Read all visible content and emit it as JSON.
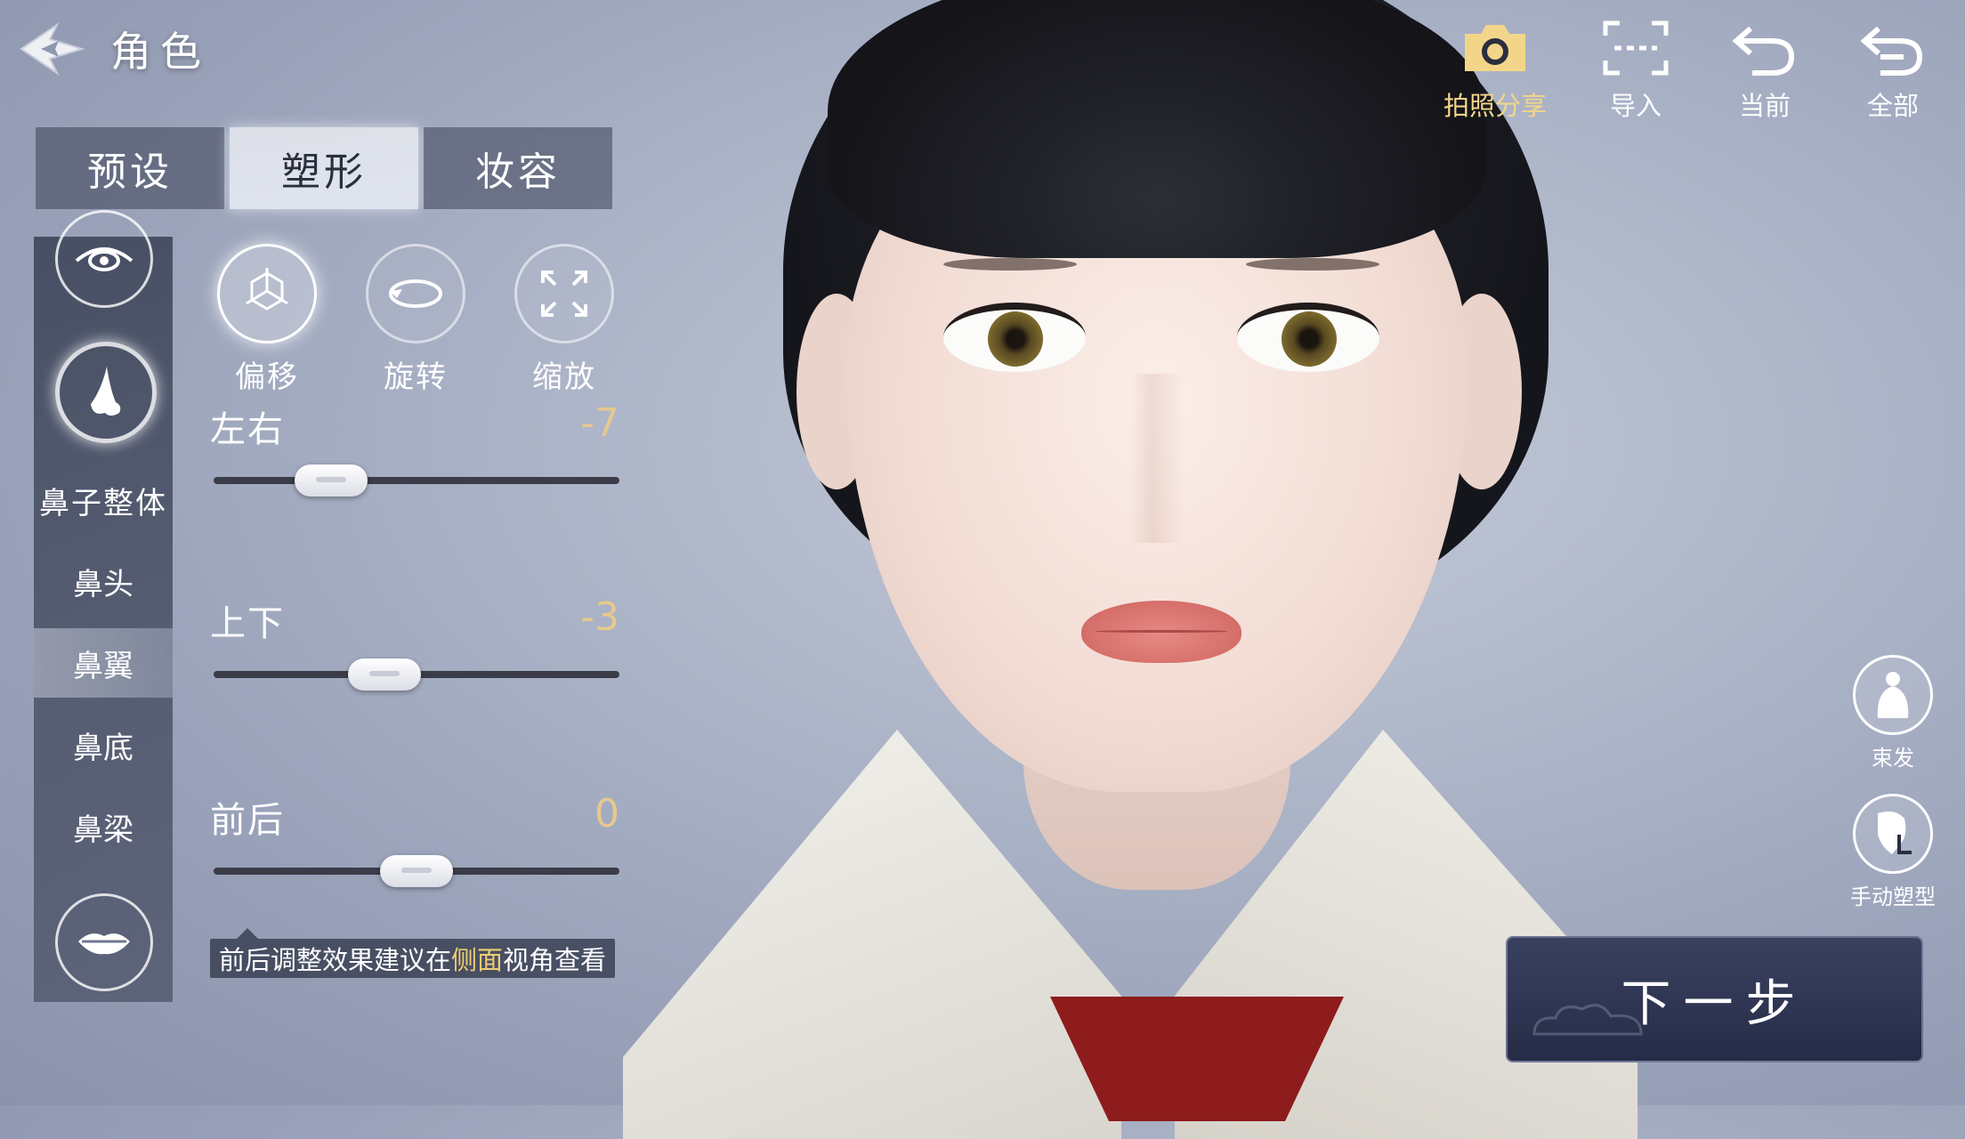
{
  "header": {
    "title": "角色"
  },
  "tabs": [
    {
      "label": "预设",
      "active": false
    },
    {
      "label": "塑形",
      "active": true
    },
    {
      "label": "妆容",
      "active": false
    }
  ],
  "top_tools": [
    {
      "label": "拍照分享",
      "icon": "camera-icon",
      "color": "#f3d58a"
    },
    {
      "label": "导入",
      "icon": "import-scan-icon"
    },
    {
      "label": "当前",
      "icon": "undo-icon"
    },
    {
      "label": "全部",
      "icon": "undo-all-icon"
    }
  ],
  "sidebar": {
    "top_icon": "eye-icon",
    "active_icon": "nose-icon",
    "active_label": "鼻子整体",
    "items": [
      {
        "label": "鼻头",
        "selected": false
      },
      {
        "label": "鼻翼",
        "selected": true
      },
      {
        "label": "鼻底",
        "selected": false
      },
      {
        "label": "鼻梁",
        "selected": false
      }
    ],
    "bottom_icon": "lips-icon"
  },
  "modes": [
    {
      "label": "偏移",
      "icon": "axis-3d-icon",
      "active": true
    },
    {
      "label": "旋转",
      "icon": "rotate-icon",
      "active": false
    },
    {
      "label": "缩放",
      "icon": "scale-icon",
      "active": false
    }
  ],
  "sliders": [
    {
      "name": "左右",
      "value": "-7",
      "fraction": 0.29
    },
    {
      "name": "上下",
      "value": "-3",
      "fraction": 0.42
    },
    {
      "name": "前后",
      "value": "0",
      "fraction": 0.5
    }
  ],
  "tip": {
    "before": "前后调整效果建议在",
    "highlight": "侧面",
    "after": "视角查看"
  },
  "right_buttons": [
    {
      "label": "束发",
      "icon": "hair-tie-icon"
    },
    {
      "label": "手动塑型",
      "icon": "manual-sculpt-icon"
    }
  ],
  "next_button": {
    "label": "下一步"
  },
  "colors": {
    "accent_gold": "#e6c98e",
    "highlight": "#f0cd72",
    "panel": "#32384c"
  }
}
